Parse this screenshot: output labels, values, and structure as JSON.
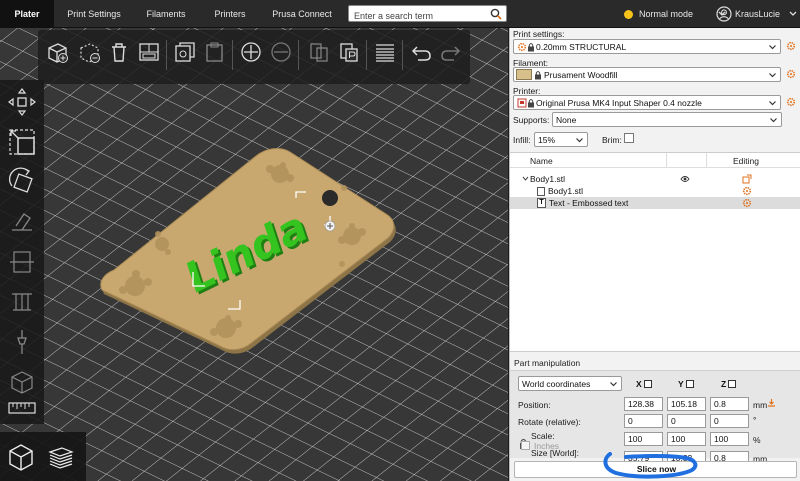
{
  "tabs": [
    "Plater",
    "Print Settings",
    "Filaments",
    "Printers",
    "Prusa Connect"
  ],
  "active_tab": "Plater",
  "search": {
    "placeholder": "Enter a search term"
  },
  "mode": {
    "label": "Normal mode",
    "color": "#f7c21a"
  },
  "user": {
    "name": "KrausLucie"
  },
  "viewport": {
    "model_text": "Linda",
    "text_color": "#35c41f",
    "plate_color": "#c9a86f",
    "bed_color": "#3a3a3a"
  },
  "top_toolbar": [
    "add-icon",
    "delete-icon",
    "delete-all-icon",
    "arrange-icon",
    "copy-icon",
    "paste-icon",
    "add-instance-icon",
    "remove-instance-icon",
    "split-to-objects-icon",
    "split-to-parts-icon",
    "variable-layer-height-icon",
    "undo-icon",
    "redo-icon"
  ],
  "left_toolbar": [
    "move-icon",
    "scale-icon",
    "rotate-icon",
    "place-on-face-icon",
    "cut-icon",
    "paint-supports-icon",
    "seam-painting-icon",
    "mmu-painting-icon",
    "measure-icon"
  ],
  "sidebar": {
    "print_settings_label": "Print settings:",
    "print_settings_value": "0.20mm STRUCTURAL",
    "filament_label": "Filament:",
    "filament_value": "Prusament Woodfill",
    "filament_color": "#d8c08b",
    "printer_label": "Printer:",
    "printer_value": "Original Prusa MK4 Input Shaper 0.4 nozzle",
    "supports_label": "Supports:",
    "supports_value": "None",
    "infill_label": "Infill:",
    "infill_value": "15%",
    "brim_label": "Brim:",
    "col_name": "Name",
    "col_editing": "Editing",
    "objects": [
      {
        "name": "Body1.stl"
      },
      {
        "name": "Body1.stl"
      },
      {
        "name": "Text - Embossed text"
      }
    ],
    "part_manipulation": {
      "title": "Part manipulation",
      "coord_select": "World coordinates",
      "axes": [
        "X",
        "Y",
        "Z"
      ],
      "position_label": "Position:",
      "position": [
        "128.38",
        "105.18",
        "0.8"
      ],
      "position_unit": "mm",
      "rotate_label": "Rotate (relative):",
      "rotate": [
        "0",
        "0",
        "0"
      ],
      "rotate_unit": "°",
      "scale_label": "Scale:",
      "scale": [
        "100",
        "100",
        "100"
      ],
      "scale_unit": "%",
      "size_label": "Size [World]:",
      "size": [
        "35.79",
        "10.33",
        "0.8"
      ],
      "size_unit": "mm",
      "inches_label": "Inches"
    },
    "slice_label": "Slice now"
  }
}
